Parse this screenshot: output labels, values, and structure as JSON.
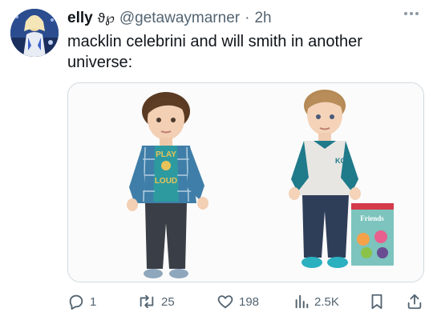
{
  "tweet": {
    "author_name": "elly",
    "author_glyphs": "ϑ℘",
    "handle": "@getawaymarner",
    "separator": "·",
    "time": "2h",
    "text": "macklin celebrini and will smith in another universe:",
    "media": {
      "doll_left_shirt": "PLAY",
      "doll_left_shirt_2": "LOUD",
      "book_title": "Friends"
    }
  },
  "actions": {
    "reply_count": "1",
    "retweet_count": "25",
    "like_count": "198",
    "views_count": "2.5K"
  },
  "colors": {
    "text_primary": "#0f1419",
    "text_secondary": "#536471",
    "border": "#cfd9de"
  },
  "icons": {
    "more": "more-dots-icon",
    "reply": "reply-icon",
    "retweet": "retweet-icon",
    "like": "heart-icon",
    "views": "views-icon",
    "bookmark": "bookmark-icon",
    "share": "share-icon"
  }
}
